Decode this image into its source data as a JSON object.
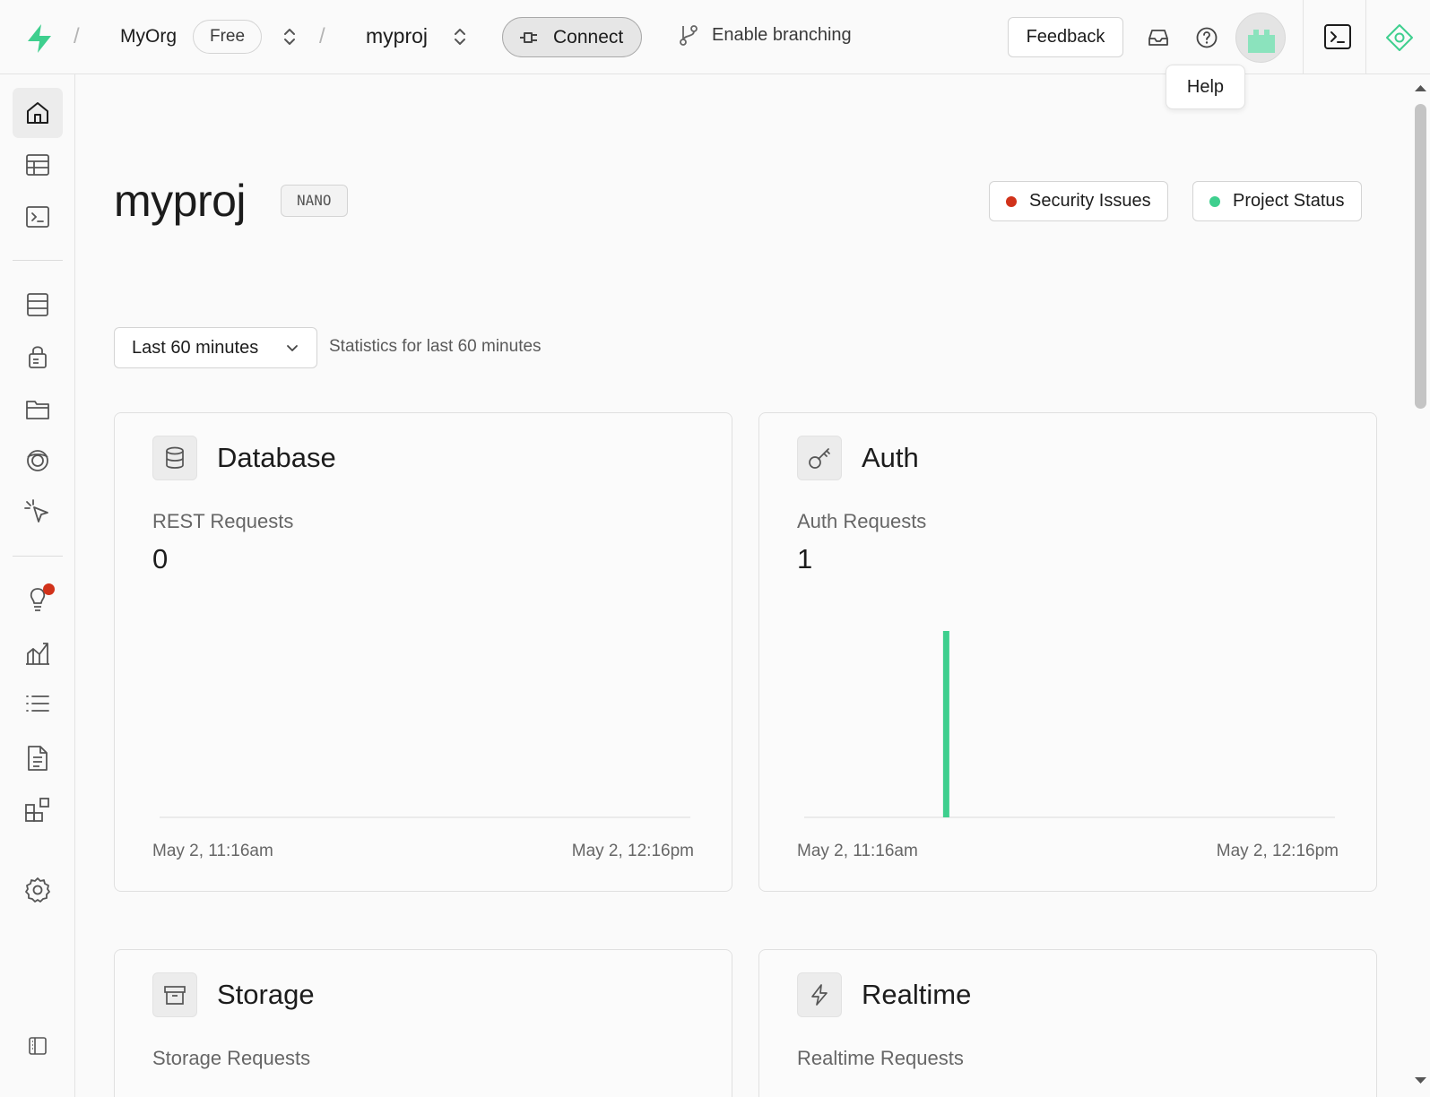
{
  "header": {
    "org_name": "MyOrg",
    "plan": "Free",
    "project_name": "myproj",
    "connect_label": "Connect",
    "branching_label": "Enable branching",
    "feedback_label": "Feedback",
    "tooltip": "Help",
    "separator": "/"
  },
  "sidebar": {
    "items": [
      {
        "name": "home-icon",
        "active": true
      },
      {
        "name": "table-editor-icon"
      },
      {
        "name": "sql-editor-icon"
      },
      {
        "name": "database-icon"
      },
      {
        "name": "auth-lock-icon"
      },
      {
        "name": "storage-icon"
      },
      {
        "name": "realtime-icon"
      },
      {
        "name": "edge-functions-icon"
      },
      {
        "name": "advisors-icon",
        "has_notification": true
      },
      {
        "name": "reports-icon"
      },
      {
        "name": "logs-icon"
      },
      {
        "name": "api-docs-icon"
      },
      {
        "name": "integrations-icon"
      },
      {
        "name": "settings-icon"
      },
      {
        "name": "collapse-sidebar-icon"
      }
    ]
  },
  "page": {
    "title": "myproj",
    "tier": "NANO",
    "security_label": "Security Issues",
    "status_label": "Project Status",
    "colors": {
      "security": "#d1321a",
      "status": "#3ecf8e",
      "accent": "#3ecf8e"
    }
  },
  "range": {
    "selected": "Last 60 minutes",
    "caption": "Statistics for last 60 minutes"
  },
  "cards": [
    {
      "title": "Database",
      "icon": "database-icon",
      "metric_label": "REST Requests",
      "metric_value": "0",
      "axis_start": "May 2, 11:16am",
      "axis_end": "May 2, 12:16pm",
      "chart_data": {
        "type": "bar",
        "values": [
          0
        ],
        "bars": []
      }
    },
    {
      "title": "Auth",
      "icon": "key-icon",
      "metric_label": "Auth Requests",
      "metric_value": "1",
      "axis_start": "May 2, 11:16am",
      "axis_end": "May 2, 12:16pm",
      "chart_data": {
        "type": "bar",
        "total_minutes": 60,
        "bars": [
          {
            "minute": 16,
            "value": 1
          }
        ],
        "ymax": 1
      }
    },
    {
      "title": "Storage",
      "icon": "storage-box-icon",
      "metric_label": "Storage Requests"
    },
    {
      "title": "Realtime",
      "icon": "bolt-icon",
      "metric_label": "Realtime Requests"
    }
  ]
}
